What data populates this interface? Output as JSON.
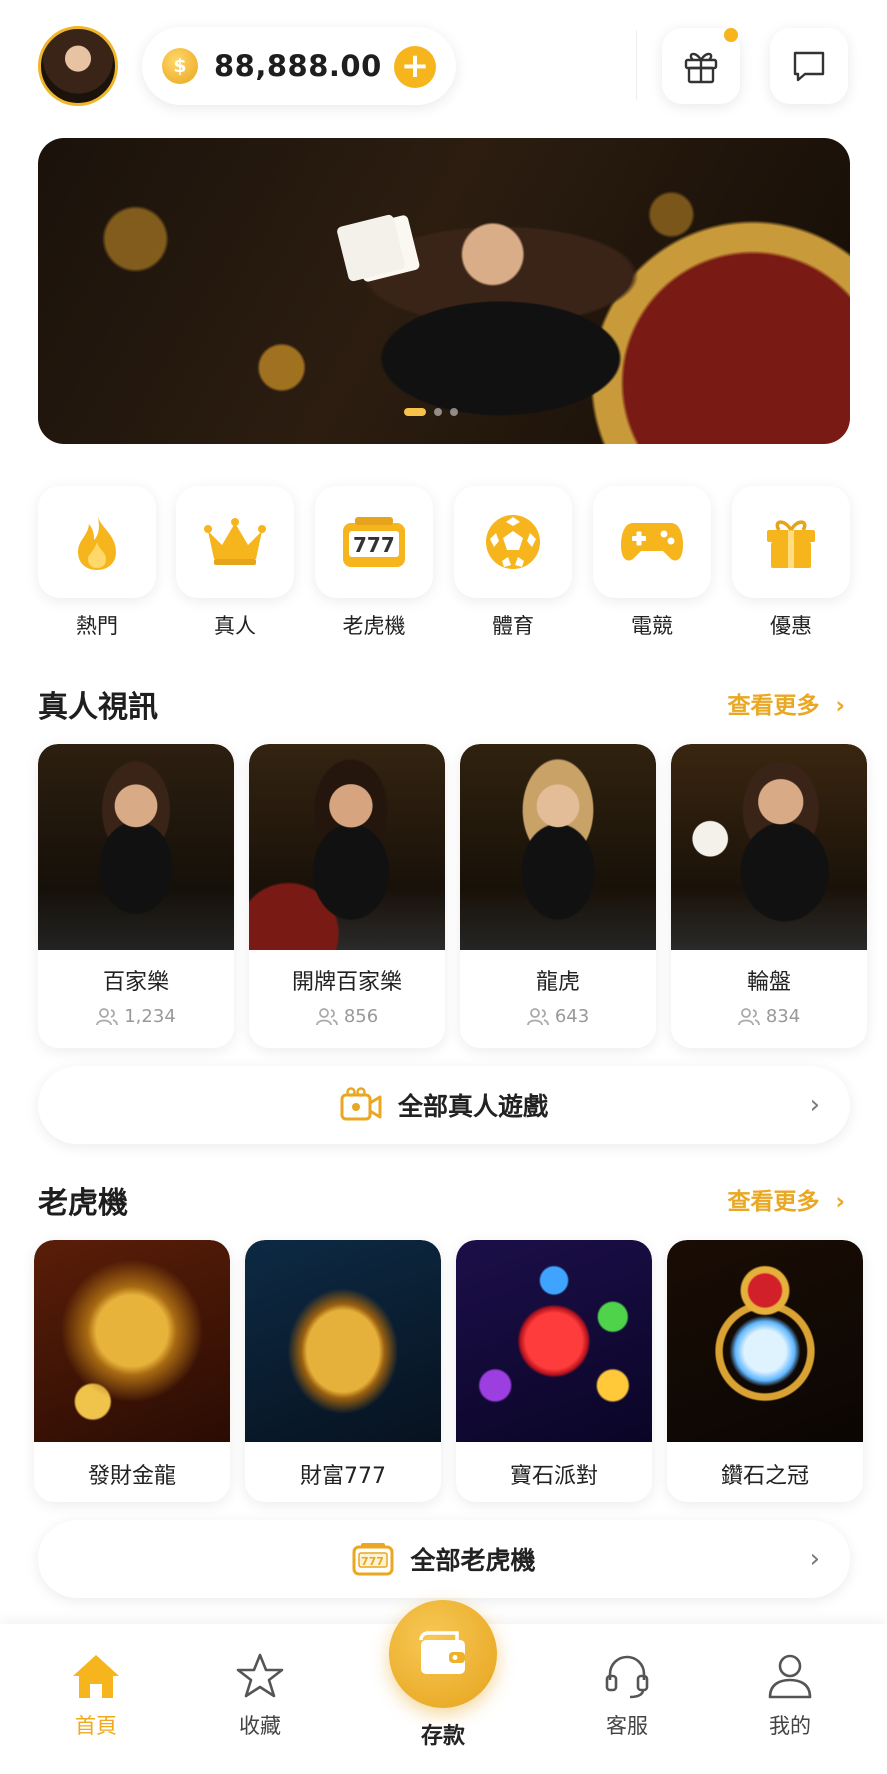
{
  "header": {
    "balance": "88,888.00",
    "coin_symbol": "$",
    "add_symbol": "+"
  },
  "categories": [
    {
      "label": "熱門",
      "icon": "flame-icon"
    },
    {
      "label": "真人",
      "icon": "crown-icon"
    },
    {
      "label": "老虎機",
      "icon": "slot-machine-icon"
    },
    {
      "label": "體育",
      "icon": "soccer-ball-icon"
    },
    {
      "label": "電競",
      "icon": "gamepad-icon"
    },
    {
      "label": "優惠",
      "icon": "gift-icon"
    }
  ],
  "live_section": {
    "title": "真人視訊",
    "more_label": "查看更多",
    "games": [
      {
        "name": "百家樂",
        "players": "1,234"
      },
      {
        "name": "開牌百家樂",
        "players": "856"
      },
      {
        "name": "龍虎",
        "players": "643"
      },
      {
        "name": "輪盤",
        "players": "834"
      }
    ],
    "all_label": "全部真人遊戲"
  },
  "slots_section": {
    "title": "老虎機",
    "more_label": "查看更多",
    "games": [
      {
        "name": "發財金龍"
      },
      {
        "name": "財富777"
      },
      {
        "name": "寶石派對"
      },
      {
        "name": "鑽石之冠"
      }
    ],
    "all_label": "全部老虎機"
  },
  "nav": {
    "home": "首頁",
    "favorites": "收藏",
    "deposit": "存款",
    "support": "客服",
    "profile": "我的"
  },
  "colors": {
    "accent": "#f6b51c",
    "accent_text": "#e9a722"
  }
}
